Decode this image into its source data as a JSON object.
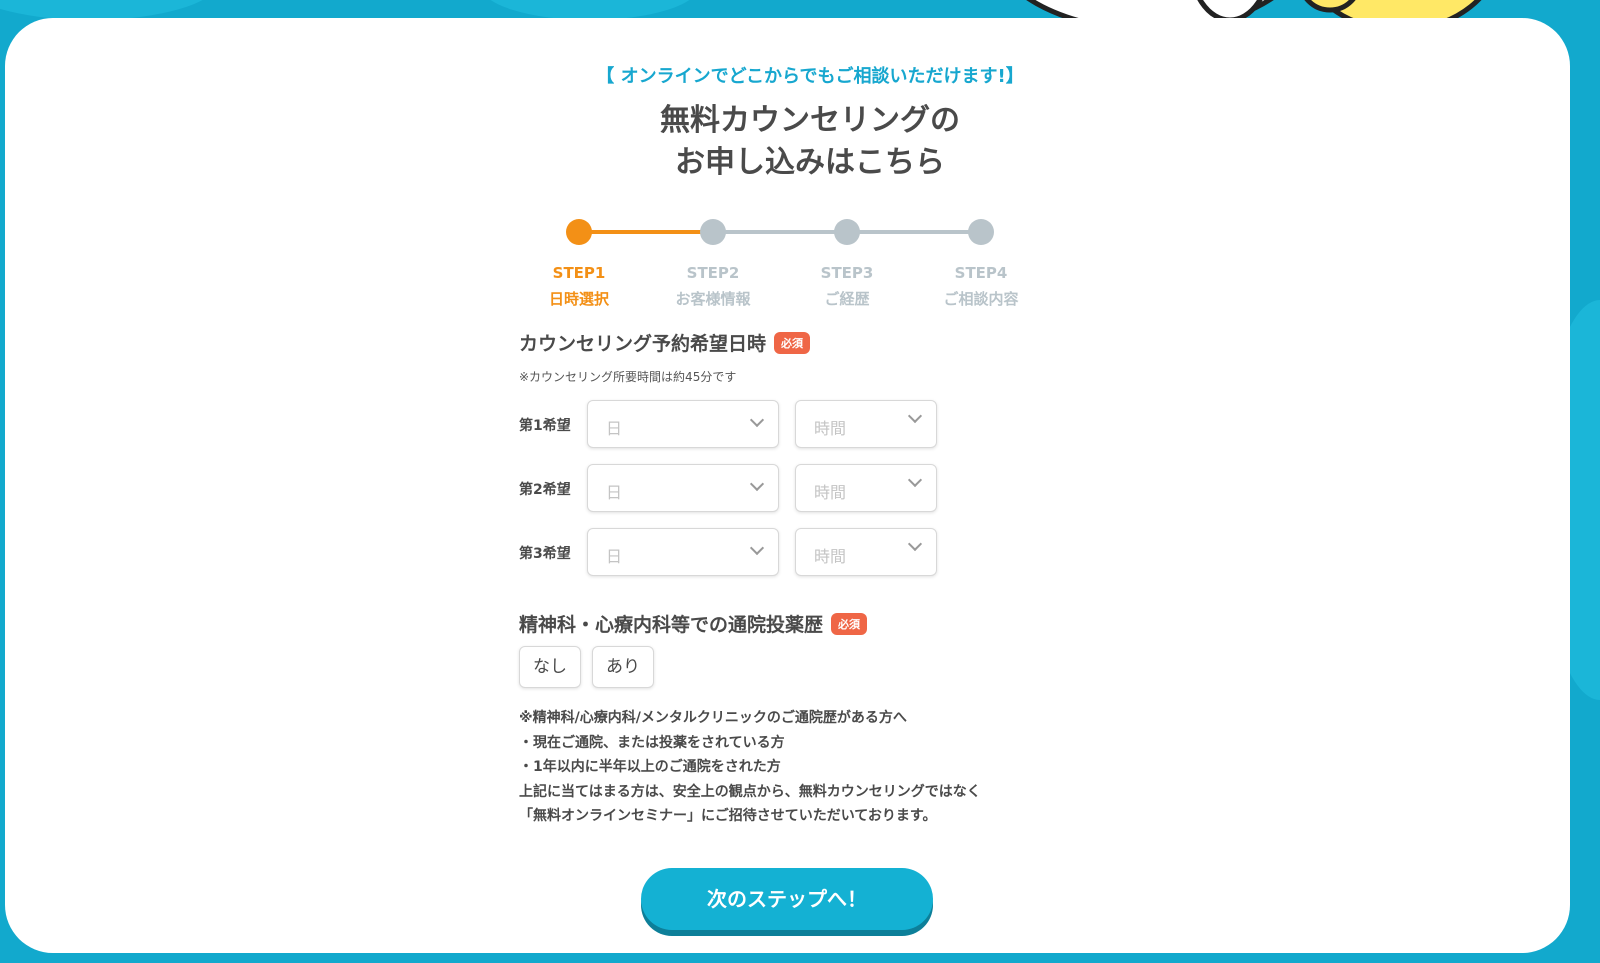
{
  "colors": {
    "background": "#12a9cd",
    "accent_blue": "#17a7cf",
    "active_orange": "#f39016",
    "inactive_gray": "#b9c4ca",
    "required_badge": "#ef6646",
    "button": "#14b1d3"
  },
  "header": {
    "tagline": "【 オンラインでどこからでもご相談いただけます!】",
    "title_line1": "無料カウンセリングの",
    "title_line2": "お申し込みはこちら"
  },
  "steps": [
    {
      "code": "STEP1",
      "label": "日時選択",
      "state": "active"
    },
    {
      "code": "STEP2",
      "label": "お客様情報",
      "state": "inactive"
    },
    {
      "code": "STEP3",
      "label": "ご経歴",
      "state": "inactive"
    },
    {
      "code": "STEP4",
      "label": "ご相談内容",
      "state": "inactive"
    }
  ],
  "schedule": {
    "title": "カウンセリング予約希望日時",
    "required": "必須",
    "note": "※カウンセリング所要時間は約45分です",
    "rows": [
      {
        "label": "第1希望",
        "date_placeholder": "日",
        "time_placeholder": "時間"
      },
      {
        "label": "第2希望",
        "date_placeholder": "日",
        "time_placeholder": "時間"
      },
      {
        "label": "第3希望",
        "date_placeholder": "日",
        "time_placeholder": "時間"
      }
    ]
  },
  "history": {
    "title": "精神科・心療内科等での通院投薬歴",
    "required": "必須",
    "options": [
      "なし",
      "あり"
    ],
    "notes": [
      "※精神科/心療内科/メンタルクリニックのご通院歴がある方へ",
      "・現在ご通院、または投薬をされている方",
      "・1年以内に半年以上のご通院をされた方",
      "上記に当てはまる方は、安全上の観点から、無料カウンセリングではなく",
      "「無料オンラインセミナー」にご招待させていただいております。"
    ]
  },
  "next_button": "次のステップへ！"
}
